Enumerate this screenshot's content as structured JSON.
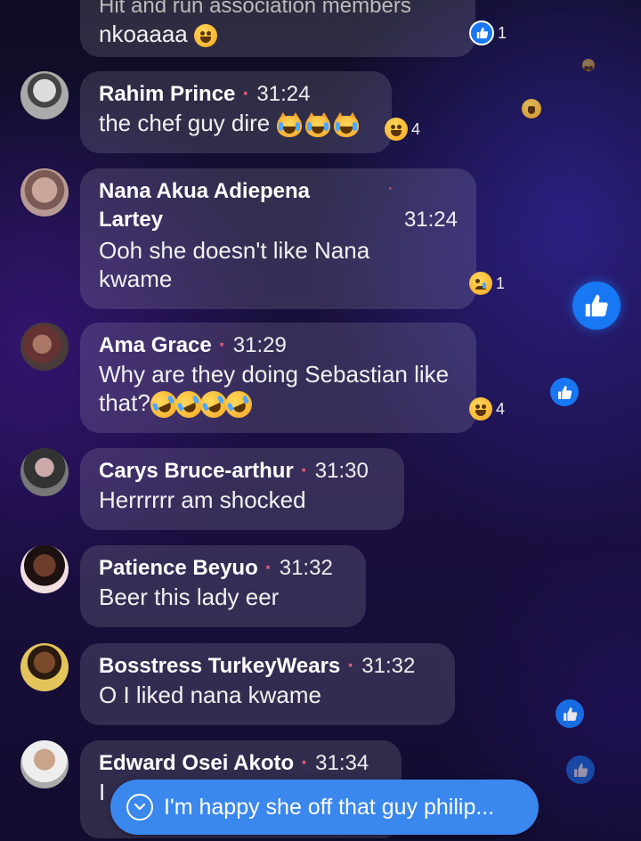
{
  "comments": [
    {
      "name": "",
      "time": "",
      "text_top": "Hit and run association members",
      "text": "nkoaaaa 😂",
      "reaction_count": "1"
    },
    {
      "name": "Rahim Prince",
      "time": "31:24",
      "text": "the chef guy dire",
      "reaction_count": "4"
    },
    {
      "name": "Nana Akua Adiepena",
      "name2": "Lartey",
      "time": "31:24",
      "text1": "Ooh she doesn't like Nana",
      "text2": "kwame",
      "reaction_count": "1"
    },
    {
      "name": "Ama Grace",
      "time": "31:29",
      "text1": "Why are they doing Sebastian like",
      "text2": "that?",
      "reaction_count": "4"
    },
    {
      "name": "Carys Bruce-arthur",
      "time": "31:30",
      "text": "Herrrrrr am shocked"
    },
    {
      "name": "Patience Beyuo",
      "time": "31:32",
      "text": "Beer this lady eer"
    },
    {
      "name": "Bosstress TurkeyWears",
      "time": "31:32",
      "text": "O I liked nana kwame"
    },
    {
      "name": "Edward Osei Akoto",
      "time": "31:34",
      "text": "I"
    }
  ],
  "new_comment_pill": "I'm happy she off that guy philip...",
  "separator": "·",
  "colors": {
    "like_blue": "#1877f2",
    "pill_blue": "#3a87ee",
    "bubble": "rgba(255,255,255,0.13)"
  },
  "icons": [
    "like-icon",
    "laugh-emoji",
    "crying-cat-emoji",
    "rofl-emoji",
    "sad-emoji",
    "chevron-down-icon"
  ]
}
